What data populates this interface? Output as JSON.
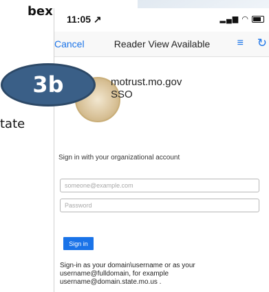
{
  "slide": {
    "top_text": "bex.",
    "side_text": "tate"
  },
  "status": {
    "time": "11:05 ↗",
    "signal": "▂▄▆",
    "wifi": "◠"
  },
  "nav": {
    "cancel": "Cancel",
    "title": "Reader View Available",
    "reader_icon": "≡",
    "reload_icon": "↻"
  },
  "site": {
    "name": "motrust.mo.gov",
    "sso": "SSO"
  },
  "form": {
    "heading": "Sign in with your organizational account",
    "email_placeholder": "someone@example.com",
    "password_placeholder": "Password",
    "sign_in_label": "Sign in",
    "help": "Sign-in as your domain\\username or as your username@fulldomain, for example username@domain.state.mo.us ."
  },
  "badge": {
    "label": "3b",
    "color": "#3a5f87"
  }
}
